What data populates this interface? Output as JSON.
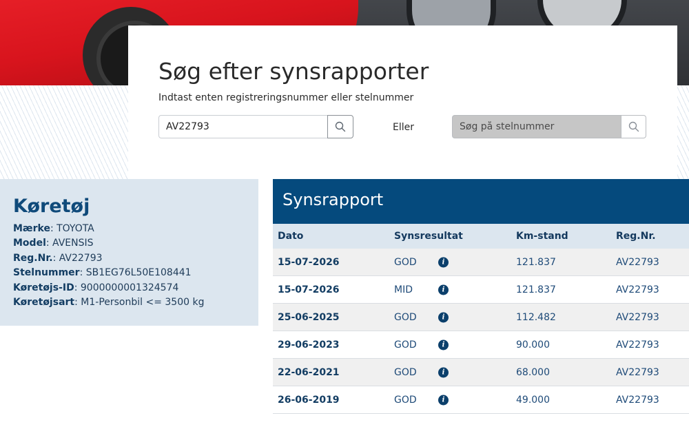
{
  "search": {
    "title": "Søg efter synsrapporter",
    "subtitle": "Indtast enten registreringsnummer eller stelnummer",
    "reg_value": "AV22793",
    "or_label": "Eller",
    "vin_placeholder": "Søg på stelnummer"
  },
  "vehicle": {
    "title": "Køretøj",
    "fields": [
      {
        "key": "Mærke",
        "value": "TOYOTA"
      },
      {
        "key": "Model",
        "value": "AVENSIS"
      },
      {
        "key": "Reg.Nr.",
        "value": "AV22793"
      },
      {
        "key": "Stelnummer",
        "value": "SB1EG76L50E108441"
      },
      {
        "key": "Køretøjs-ID",
        "value": "9000000001324574"
      },
      {
        "key": "Køretøjsart",
        "value": "M1-Personbil <= 3500 kg"
      }
    ]
  },
  "report": {
    "title": "Synsrapport",
    "columns": [
      "Dato",
      "Synsresultat",
      "Km-stand",
      "Reg.Nr."
    ],
    "rows": [
      {
        "date": "15-07-2026",
        "result": "GOD",
        "km": "121.837",
        "reg": "AV22793"
      },
      {
        "date": "15-07-2026",
        "result": "MID",
        "km": "121.837",
        "reg": "AV22793"
      },
      {
        "date": "25-06-2025",
        "result": "GOD",
        "km": "112.482",
        "reg": "AV22793"
      },
      {
        "date": "29-06-2023",
        "result": "GOD",
        "km": "90.000",
        "reg": "AV22793"
      },
      {
        "date": "22-06-2021",
        "result": "GOD",
        "km": "68.000",
        "reg": "AV22793"
      },
      {
        "date": "26-06-2019",
        "result": "GOD",
        "km": "49.000",
        "reg": "AV22793"
      }
    ]
  },
  "colors": {
    "primary": "#054a7d",
    "panel": "#dce6ef",
    "icon": "#0b3f6b"
  },
  "icons": {
    "search": "search-icon",
    "info": "info-icon"
  }
}
